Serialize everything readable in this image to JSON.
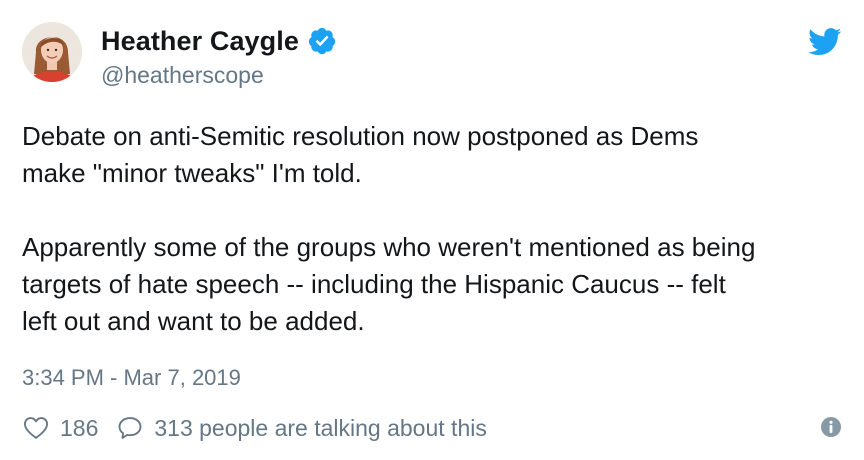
{
  "author": {
    "display_name": "Heather Caygle",
    "handle": "@heatherscope",
    "verified": true
  },
  "tweet": {
    "paragraphs": [
      "Debate on anti-Semitic resolution now postponed as Dems\nmake \"minor tweaks\" I'm told.",
      "Apparently some of the groups who weren't mentioned as being\ntargets of hate speech -- including the Hispanic Caucus -- felt\nleft out and want to be added."
    ],
    "timestamp": "3:34 PM - Mar 7, 2019"
  },
  "actions": {
    "likes": "186",
    "replies_text": "313 people are talking about this"
  },
  "icons": {
    "verified": "verified-badge-icon",
    "bird": "twitter-bird-icon",
    "like": "heart-icon",
    "reply": "speech-bubble-icon",
    "info": "info-icon"
  },
  "colors": {
    "twitter_blue": "#1da1f2",
    "text": "#14171a",
    "secondary": "#657786"
  }
}
